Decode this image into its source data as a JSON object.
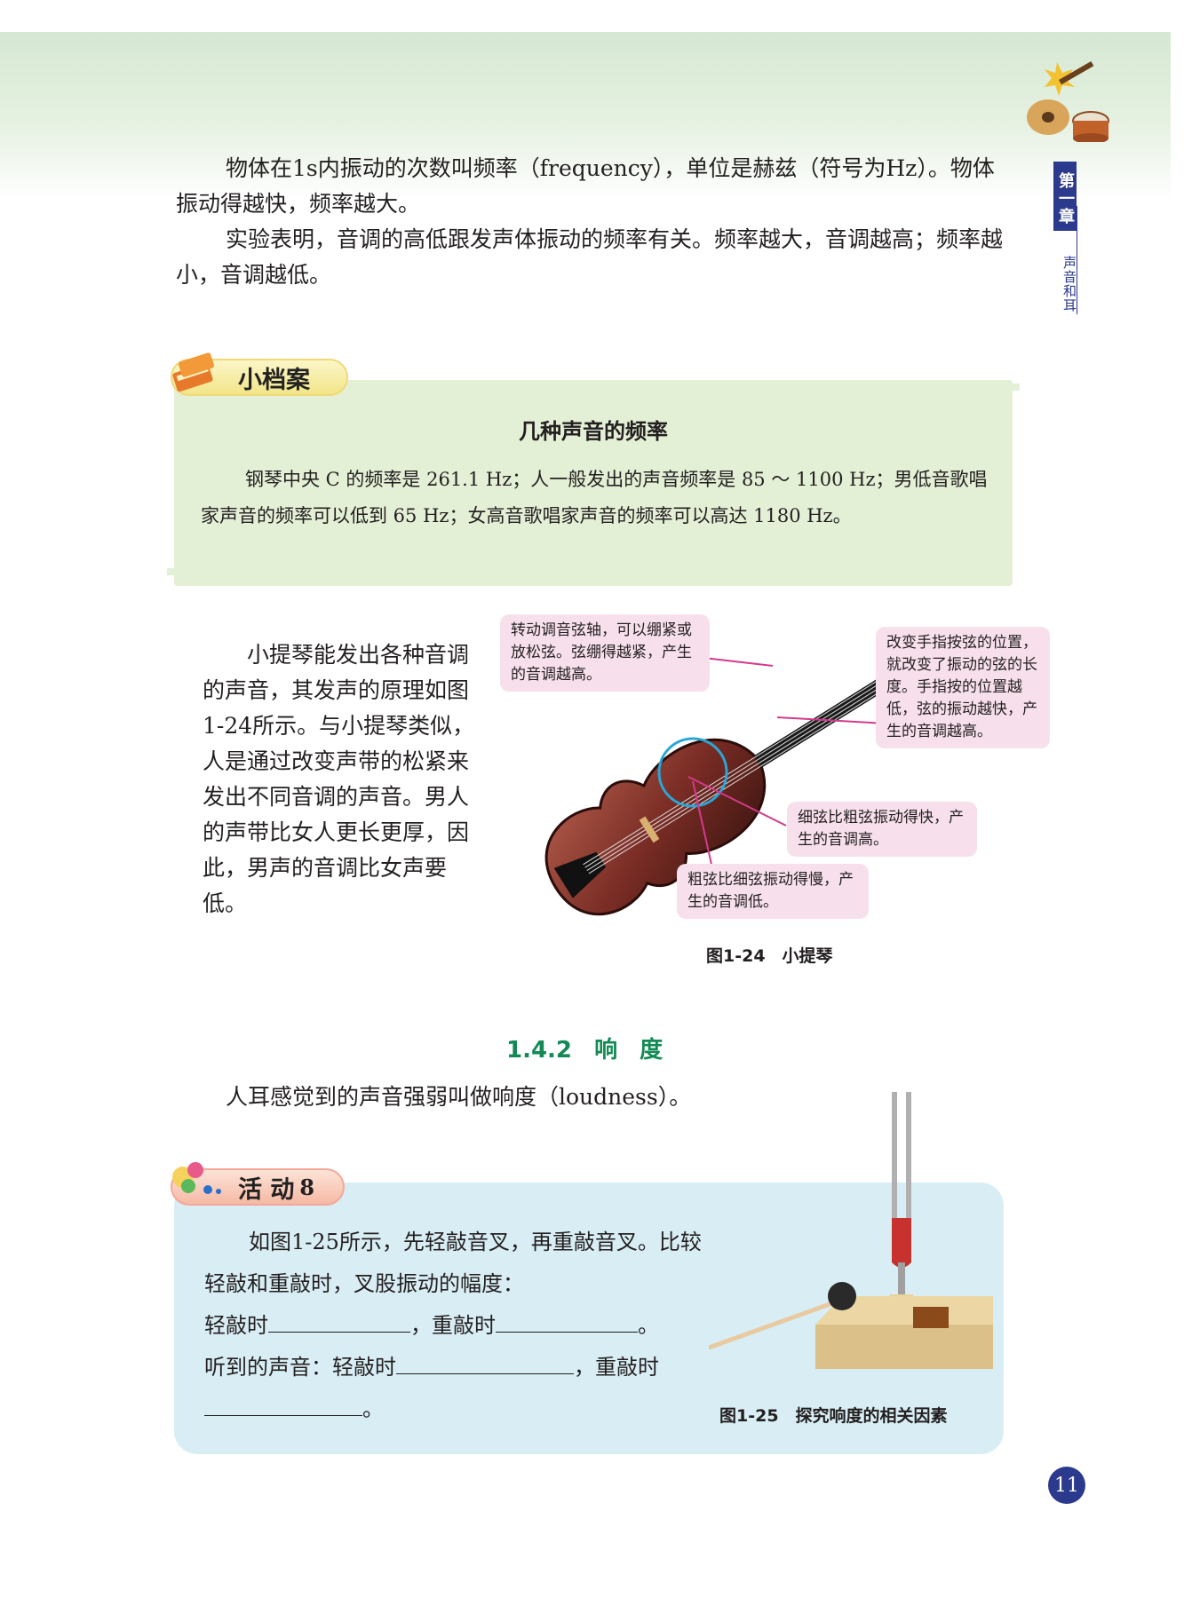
{
  "header": {
    "chapter_tab": "第一章",
    "chapter_title": "声音和耳"
  },
  "intro": {
    "p1": "物体在1s内振动的次数叫频率（frequency），单位是赫兹（符号为Hz）。物体振动得越快，频率越大。",
    "p2": "实验表明，音调的高低跟发声体振动的频率有关。频率越大，音调越高；频率越小，音调越低。"
  },
  "archive": {
    "label": "小档案",
    "title": "几种声音的频率",
    "text": "钢琴中央 C 的频率是 261.1 Hz；人一般发出的声音频率是 85 ～ 1100 Hz；男低音歌唱家声音的频率可以低到 65 Hz；女高音歌唱家声音的频率可以高达 1180 Hz。"
  },
  "violin": {
    "paragraph": "小提琴能发出各种音调的声音，其发声的原理如图1-24所示。与小提琴类似，人是通过改变声带的松紧来发出不同音调的声音。男人的声带比女人更长更厚，因此，男声的音调比女声要低。",
    "callout_peg": "转动调音弦轴，可以绷紧或放松弦。弦绷得越紧，产生的音调越高。",
    "callout_finger": "改变手指按弦的位置，就改变了振动的弦的长度。手指按的位置越低，弦的振动越快，产生的音调越高。",
    "callout_thin": "细弦比粗弦振动得快，产生的音调高。",
    "callout_thick": "粗弦比细弦振动得慢，产生的音调低。",
    "caption": "图1-24　小提琴"
  },
  "section": {
    "heading": "1.4.2 响 度",
    "definition": "人耳感觉到的声音强弱叫做响度（loudness）。"
  },
  "activity": {
    "label": "活 动",
    "number": "8",
    "line1": "如图1-25所示，先轻敲音叉，再重敲音叉。比较轻敲和重敲时，叉股振动的幅度：",
    "light_label": "轻敲时",
    "heavy_label": "，重敲时",
    "period": "。",
    "sound_label": "听到的声音：轻敲时",
    "sound_heavy": "，重敲时",
    "caption": "图1-25　探究响度的相关因素"
  },
  "page_number": "11"
}
